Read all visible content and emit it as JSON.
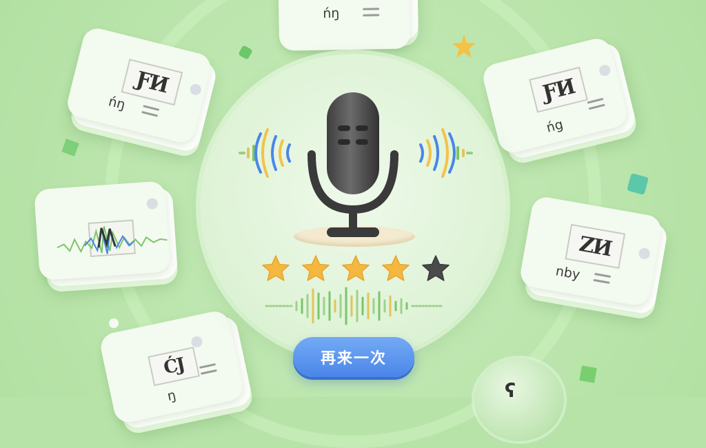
{
  "cards": [
    {
      "pron": "ńŋ"
    },
    {
      "glyph": "ƑИ",
      "pron": "ńŋ"
    },
    {
      "glyph": "ƑИ",
      "pron": "ńg"
    },
    {
      "glyph": "ZИ",
      "pron": "nby"
    },
    {
      "glyph": "ĆJ",
      "pron": "ŋ"
    }
  ],
  "rating": {
    "filled": 4,
    "total": 5
  },
  "retry_button": {
    "label": "再来一次"
  },
  "bubble_glyph": "ʕ",
  "colors": {
    "background": "#b7e3a8",
    "star_gold": "#f4b740",
    "star_empty": "#4a4a4a",
    "button_blue": "#4a86e8",
    "wave_blue": "#4a86e8",
    "wave_yellow": "#f2c24a",
    "wave_green": "#7cc46a"
  },
  "icons": {
    "microphone": "microphone-icon",
    "sound_wave": "sound-wave-icon",
    "star": "star-icon"
  }
}
